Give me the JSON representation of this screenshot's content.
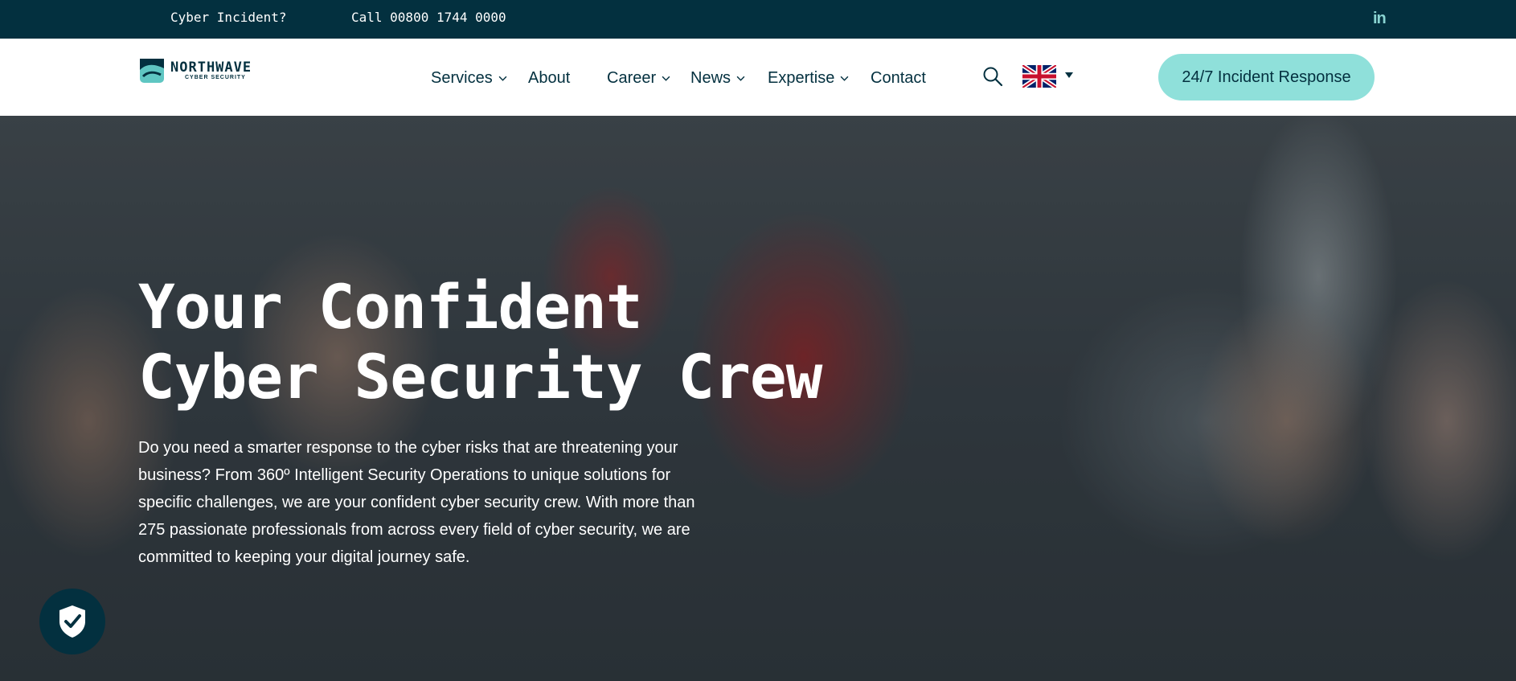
{
  "topbar": {
    "cyber_incident": "Cyber Incident?",
    "call": "Call 00800 1744 0000",
    "linkedin": "in"
  },
  "logo": {
    "name": "NORTHWAVE",
    "tagline": "CYBER SECURITY"
  },
  "nav": {
    "items": [
      {
        "label": "Services",
        "dropdown": true
      },
      {
        "label": "About",
        "dropdown": false
      },
      {
        "label": "Career",
        "dropdown": true
      },
      {
        "label": "News",
        "dropdown": true
      },
      {
        "label": "Expertise",
        "dropdown": true
      },
      {
        "label": "Contact",
        "dropdown": false
      }
    ],
    "search_icon": "search-icon",
    "language_flag": "uk-flag-icon",
    "cta_label": "24/7 Incident Response"
  },
  "hero": {
    "title_line1": "Your Confident",
    "title_line2": "Cyber Security Crew",
    "paragraph": "Do you need a smarter response to the cyber risks that are threatening your business? From 360º Intelligent Security Operations to unique solutions for specific challenges, we are your confident cyber security crew. With more than 275 passionate professionals from across every field of cyber security, we are committed to keeping your digital journey safe."
  },
  "colors": {
    "dark": "#03303f",
    "accent": "#8fe0da",
    "linkedin": "#8ad4d2"
  }
}
